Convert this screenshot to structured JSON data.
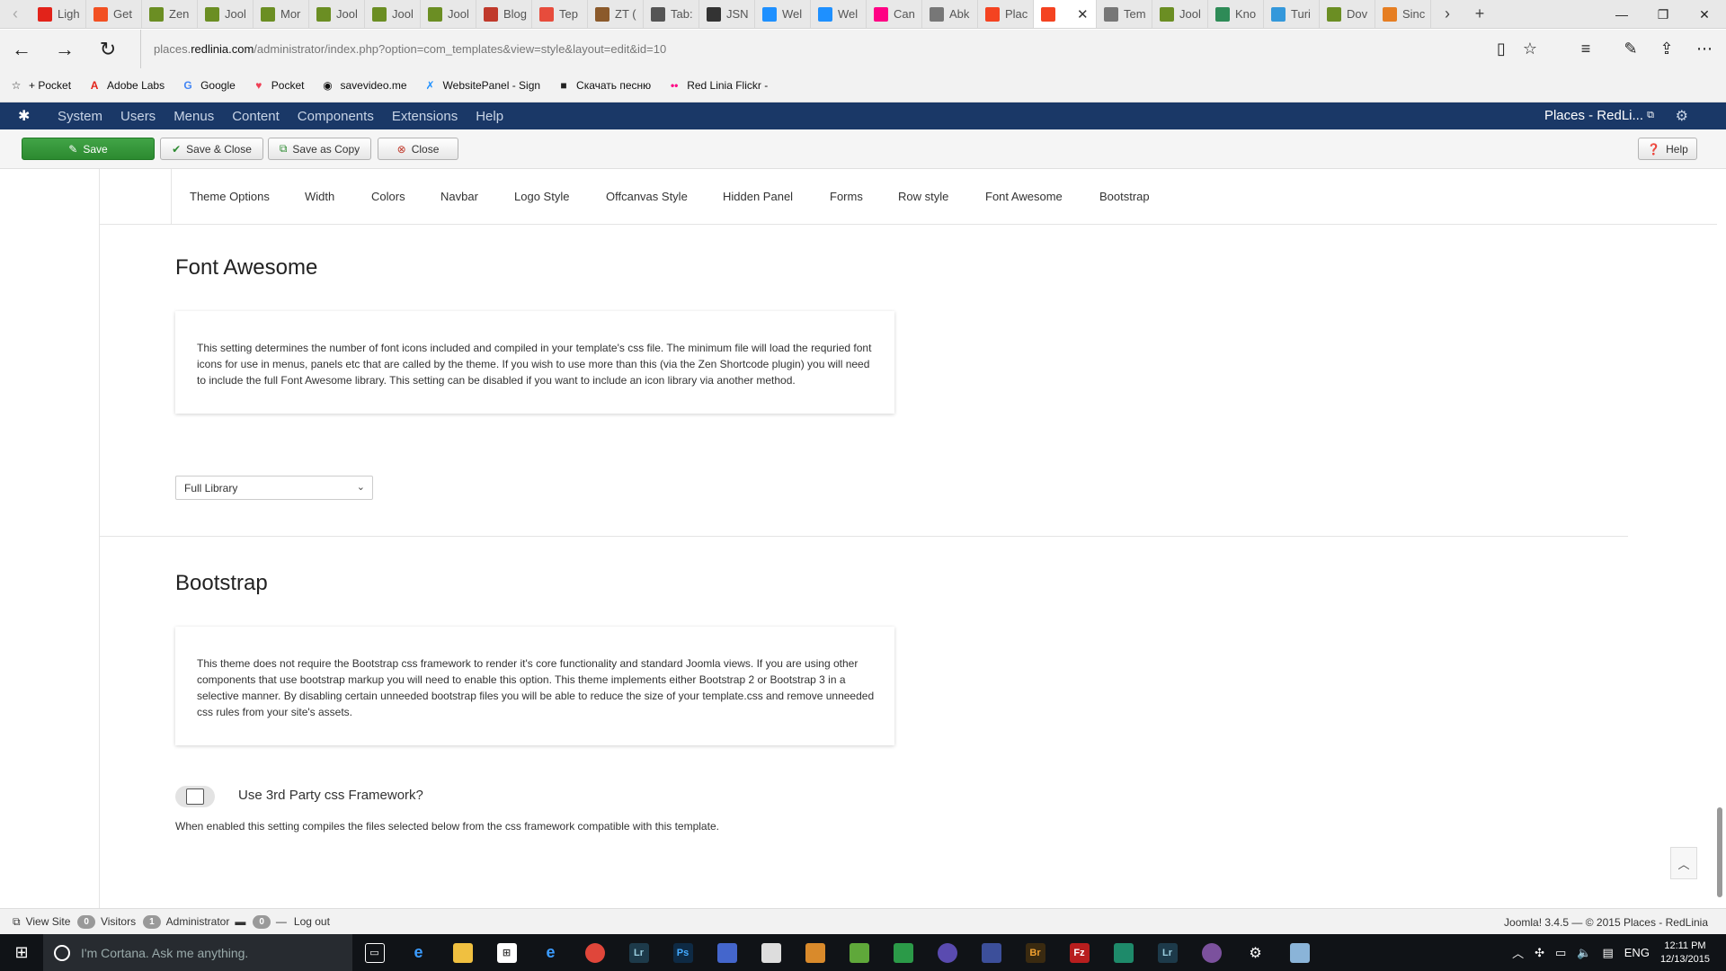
{
  "browser": {
    "tabs": [
      {
        "label": "Ligh",
        "icon": "adobe-icon",
        "color": "#e2231a"
      },
      {
        "label": "Get",
        "icon": "windows-store-icon",
        "color": "#f25022"
      },
      {
        "label": "Zen",
        "icon": "zen-icon",
        "color": "#6b8e23"
      },
      {
        "label": "Jool",
        "icon": "zen-icon",
        "color": "#6b8e23"
      },
      {
        "label": "Mor",
        "icon": "zen-icon",
        "color": "#6b8e23"
      },
      {
        "label": "Jool",
        "icon": "zen-icon",
        "color": "#6b8e23"
      },
      {
        "label": "Jool",
        "icon": "zen-icon",
        "color": "#6b8e23"
      },
      {
        "label": "Jool",
        "icon": "zen-icon",
        "color": "#6b8e23"
      },
      {
        "label": "Blog",
        "icon": "blog-icon",
        "color": "#c0392b"
      },
      {
        "label": "Tep",
        "icon": "tep-icon",
        "color": "#e74c3c"
      },
      {
        "label": "ZT (",
        "icon": "zt-icon",
        "color": "#8b5a2b"
      },
      {
        "label": "Tab:",
        "icon": "tab-icon",
        "color": "#555555"
      },
      {
        "label": "JSN",
        "icon": "jsn-icon",
        "color": "#333333"
      },
      {
        "label": "Wel",
        "icon": "wel-icon",
        "color": "#1e90ff"
      },
      {
        "label": "Wel",
        "icon": "wel-icon",
        "color": "#1e90ff"
      },
      {
        "label": "Can",
        "icon": "flickr-icon",
        "color": "#ff0084"
      },
      {
        "label": "Abk",
        "icon": "page-icon",
        "color": "#777777"
      },
      {
        "label": "Plac",
        "icon": "joomla-icon",
        "color": "#f44321"
      },
      {
        "label": "",
        "icon": "joomla-icon",
        "color": "#f44321",
        "active": true
      },
      {
        "label": "Tem",
        "icon": "page-icon",
        "color": "#777777"
      },
      {
        "label": "Jool",
        "icon": "zen-icon",
        "color": "#6b8e23"
      },
      {
        "label": "Kno",
        "icon": "kno-icon",
        "color": "#2e8b57"
      },
      {
        "label": "Turi",
        "icon": "turi-icon",
        "color": "#3498db"
      },
      {
        "label": "Dov",
        "icon": "zen-icon",
        "color": "#6b8e23"
      },
      {
        "label": "Sinc",
        "icon": "sinc-icon",
        "color": "#e67e22"
      }
    ],
    "url_host": "places.",
    "url_domain": "redlinia.com",
    "url_path": "/administrator/index.php?option=com_templates&view=style&layout=edit&id=10",
    "favorites": [
      {
        "label": "+ Pocket",
        "icon": "star-icon"
      },
      {
        "label": "Adobe Labs",
        "icon": "adobe-icon"
      },
      {
        "label": "Google",
        "icon": "google-icon"
      },
      {
        "label": "Pocket",
        "icon": "pocket-icon"
      },
      {
        "label": "savevideo.me",
        "icon": "savevideo-icon"
      },
      {
        "label": "WebsitePanel - Sign",
        "icon": "websitepanel-icon"
      },
      {
        "label": "Скачать песню",
        "icon": "music-icon"
      },
      {
        "label": "Red Linia  Flickr -",
        "icon": "flickr-icon"
      }
    ]
  },
  "joomla_nav": {
    "menu": [
      "System",
      "Users",
      "Menus",
      "Content",
      "Components",
      "Extensions",
      "Help"
    ],
    "site_title": "Places - RedLi..."
  },
  "toolbar": {
    "save_label": "Save",
    "save_close_label": "Save & Close",
    "save_copy_label": "Save as Copy",
    "close_label": "Close",
    "help_label": "Help"
  },
  "settings_tabs": [
    "Theme Options",
    "Width",
    "Colors",
    "Navbar",
    "Logo Style",
    "Offcanvas Style",
    "Hidden Panel",
    "Forms",
    "Row style",
    "Font Awesome",
    "Bootstrap"
  ],
  "font_awesome": {
    "title": "Font Awesome",
    "description": "This setting determines the number of font icons included and compiled in your template's css file. The minimum file will load the requried font icons for use in menus, panels etc that are called by the theme. If you wish to use more than this (via the Zen Shortcode plugin) you will need to include the full Font Awesome library. This setting can be disabled if you want to include an icon library via another method.",
    "select_value": "Full Library"
  },
  "bootstrap": {
    "title": "Bootstrap",
    "description": "This theme does not require the Bootstrap css framework to render it's core functionality and standard Joomla views. If you are using other components that use bootstrap markup you will need to enable this option. This theme implements either Bootstrap 2 or Bootstrap 3 in a selective manner. By disabling certain unneeded bootstrap files you will be able to reduce the size of your template.css and remove unneeded css rules from your site's assets.",
    "toggle_label": "Use 3rd Party css Framework?",
    "toggle_help": "When enabled this setting compiles the files selected below from the css framework compatible with this template."
  },
  "statusbar": {
    "view_site": "View Site",
    "visitors_count": "0",
    "visitors_label": "Visitors",
    "admin_count": "1",
    "admin_label": "Administrator",
    "messages_count": "0",
    "logout_label": "Log out",
    "version": "Joomla! 3.4.5  —  © 2015 Places - RedLinia"
  },
  "taskbar": {
    "cortana_placeholder": "I'm Cortana. Ask me anything.",
    "language": "ENG",
    "time": "12:11 PM",
    "date": "12/13/2015"
  },
  "colors": {
    "joomla_nav_bg": "#1a3867",
    "save_green": "#2f8f33"
  }
}
